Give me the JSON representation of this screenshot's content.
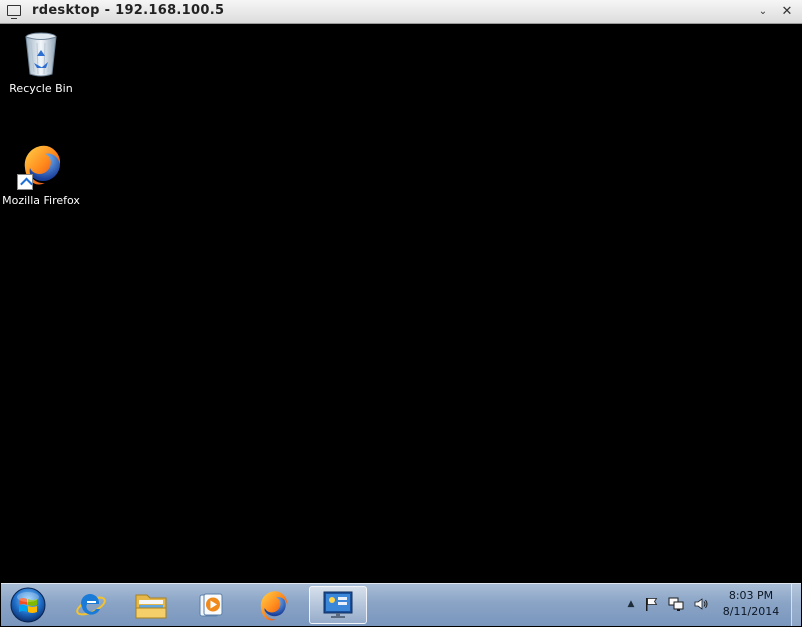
{
  "window": {
    "title": "rdesktop - 192.168.100.5",
    "menu_glyph": "⌄",
    "close_glyph": "✕"
  },
  "desktop": {
    "icons": [
      {
        "label": "Recycle Bin",
        "icon": "recycle-bin-icon"
      },
      {
        "label": "Mozilla Firefox",
        "icon": "firefox-icon"
      }
    ]
  },
  "taskbar": {
    "pinned": [
      {
        "name": "internet-explorer",
        "icon": "ie-icon"
      },
      {
        "name": "windows-explorer",
        "icon": "folder-icon"
      },
      {
        "name": "windows-media-player",
        "icon": "media-player-icon"
      },
      {
        "name": "firefox",
        "icon": "firefox-icon"
      },
      {
        "name": "remote-desktop",
        "icon": "rdp-icon",
        "active": true
      }
    ],
    "tray": {
      "show_hidden_glyph": "▲"
    },
    "clock": {
      "time": "8:03 PM",
      "date": "8/11/2014"
    }
  },
  "colors": {
    "desktop_bg": "#000000",
    "taskbar_top": "#a9bdd6",
    "taskbar_bottom": "#7a96bd"
  }
}
